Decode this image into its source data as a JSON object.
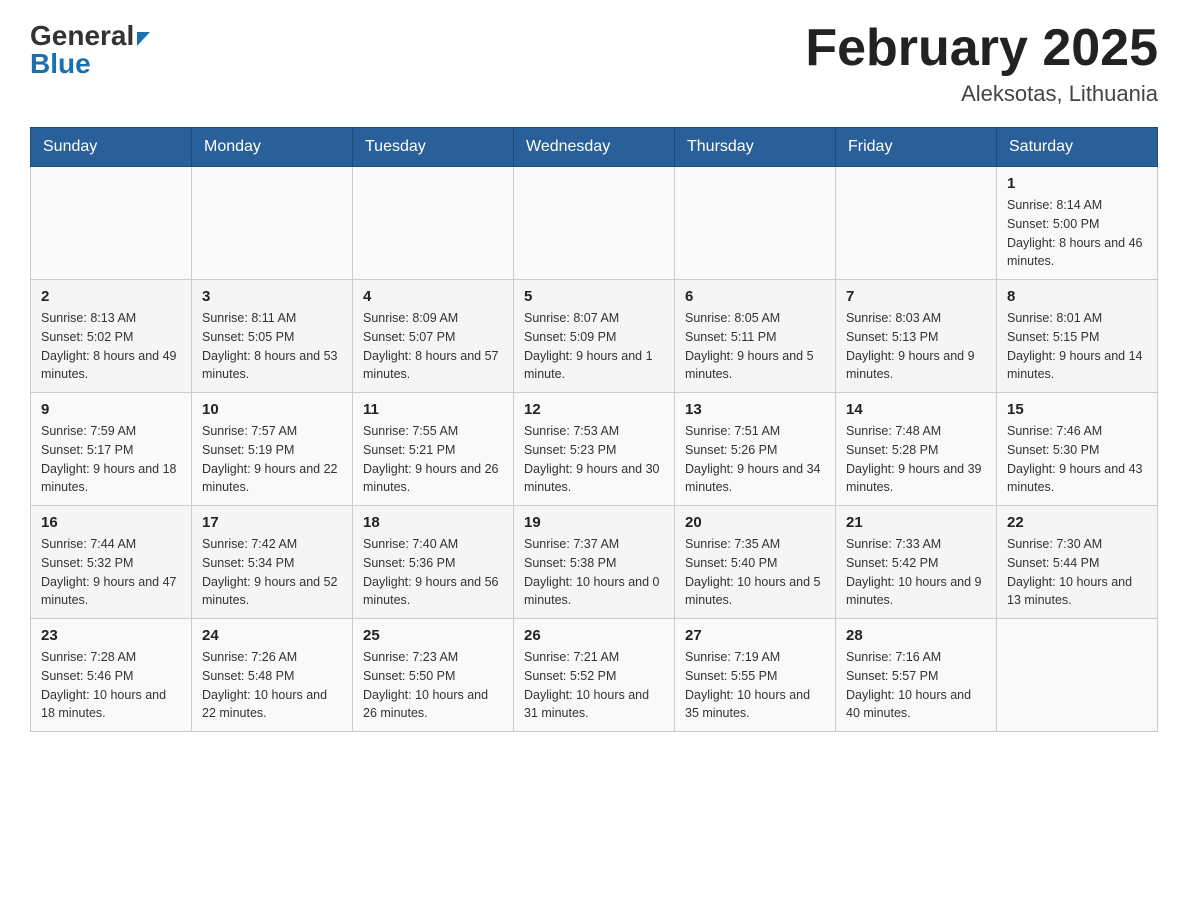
{
  "header": {
    "logo_general": "General",
    "logo_blue": "Blue",
    "month_year": "February 2025",
    "location": "Aleksotas, Lithuania"
  },
  "days_of_week": [
    "Sunday",
    "Monday",
    "Tuesday",
    "Wednesday",
    "Thursday",
    "Friday",
    "Saturday"
  ],
  "weeks": [
    [
      {
        "day": "",
        "info": ""
      },
      {
        "day": "",
        "info": ""
      },
      {
        "day": "",
        "info": ""
      },
      {
        "day": "",
        "info": ""
      },
      {
        "day": "",
        "info": ""
      },
      {
        "day": "",
        "info": ""
      },
      {
        "day": "1",
        "info": "Sunrise: 8:14 AM\nSunset: 5:00 PM\nDaylight: 8 hours and 46 minutes."
      }
    ],
    [
      {
        "day": "2",
        "info": "Sunrise: 8:13 AM\nSunset: 5:02 PM\nDaylight: 8 hours and 49 minutes."
      },
      {
        "day": "3",
        "info": "Sunrise: 8:11 AM\nSunset: 5:05 PM\nDaylight: 8 hours and 53 minutes."
      },
      {
        "day": "4",
        "info": "Sunrise: 8:09 AM\nSunset: 5:07 PM\nDaylight: 8 hours and 57 minutes."
      },
      {
        "day": "5",
        "info": "Sunrise: 8:07 AM\nSunset: 5:09 PM\nDaylight: 9 hours and 1 minute."
      },
      {
        "day": "6",
        "info": "Sunrise: 8:05 AM\nSunset: 5:11 PM\nDaylight: 9 hours and 5 minutes."
      },
      {
        "day": "7",
        "info": "Sunrise: 8:03 AM\nSunset: 5:13 PM\nDaylight: 9 hours and 9 minutes."
      },
      {
        "day": "8",
        "info": "Sunrise: 8:01 AM\nSunset: 5:15 PM\nDaylight: 9 hours and 14 minutes."
      }
    ],
    [
      {
        "day": "9",
        "info": "Sunrise: 7:59 AM\nSunset: 5:17 PM\nDaylight: 9 hours and 18 minutes."
      },
      {
        "day": "10",
        "info": "Sunrise: 7:57 AM\nSunset: 5:19 PM\nDaylight: 9 hours and 22 minutes."
      },
      {
        "day": "11",
        "info": "Sunrise: 7:55 AM\nSunset: 5:21 PM\nDaylight: 9 hours and 26 minutes."
      },
      {
        "day": "12",
        "info": "Sunrise: 7:53 AM\nSunset: 5:23 PM\nDaylight: 9 hours and 30 minutes."
      },
      {
        "day": "13",
        "info": "Sunrise: 7:51 AM\nSunset: 5:26 PM\nDaylight: 9 hours and 34 minutes."
      },
      {
        "day": "14",
        "info": "Sunrise: 7:48 AM\nSunset: 5:28 PM\nDaylight: 9 hours and 39 minutes."
      },
      {
        "day": "15",
        "info": "Sunrise: 7:46 AM\nSunset: 5:30 PM\nDaylight: 9 hours and 43 minutes."
      }
    ],
    [
      {
        "day": "16",
        "info": "Sunrise: 7:44 AM\nSunset: 5:32 PM\nDaylight: 9 hours and 47 minutes."
      },
      {
        "day": "17",
        "info": "Sunrise: 7:42 AM\nSunset: 5:34 PM\nDaylight: 9 hours and 52 minutes."
      },
      {
        "day": "18",
        "info": "Sunrise: 7:40 AM\nSunset: 5:36 PM\nDaylight: 9 hours and 56 minutes."
      },
      {
        "day": "19",
        "info": "Sunrise: 7:37 AM\nSunset: 5:38 PM\nDaylight: 10 hours and 0 minutes."
      },
      {
        "day": "20",
        "info": "Sunrise: 7:35 AM\nSunset: 5:40 PM\nDaylight: 10 hours and 5 minutes."
      },
      {
        "day": "21",
        "info": "Sunrise: 7:33 AM\nSunset: 5:42 PM\nDaylight: 10 hours and 9 minutes."
      },
      {
        "day": "22",
        "info": "Sunrise: 7:30 AM\nSunset: 5:44 PM\nDaylight: 10 hours and 13 minutes."
      }
    ],
    [
      {
        "day": "23",
        "info": "Sunrise: 7:28 AM\nSunset: 5:46 PM\nDaylight: 10 hours and 18 minutes."
      },
      {
        "day": "24",
        "info": "Sunrise: 7:26 AM\nSunset: 5:48 PM\nDaylight: 10 hours and 22 minutes."
      },
      {
        "day": "25",
        "info": "Sunrise: 7:23 AM\nSunset: 5:50 PM\nDaylight: 10 hours and 26 minutes."
      },
      {
        "day": "26",
        "info": "Sunrise: 7:21 AM\nSunset: 5:52 PM\nDaylight: 10 hours and 31 minutes."
      },
      {
        "day": "27",
        "info": "Sunrise: 7:19 AM\nSunset: 5:55 PM\nDaylight: 10 hours and 35 minutes."
      },
      {
        "day": "28",
        "info": "Sunrise: 7:16 AM\nSunset: 5:57 PM\nDaylight: 10 hours and 40 minutes."
      },
      {
        "day": "",
        "info": ""
      }
    ]
  ]
}
